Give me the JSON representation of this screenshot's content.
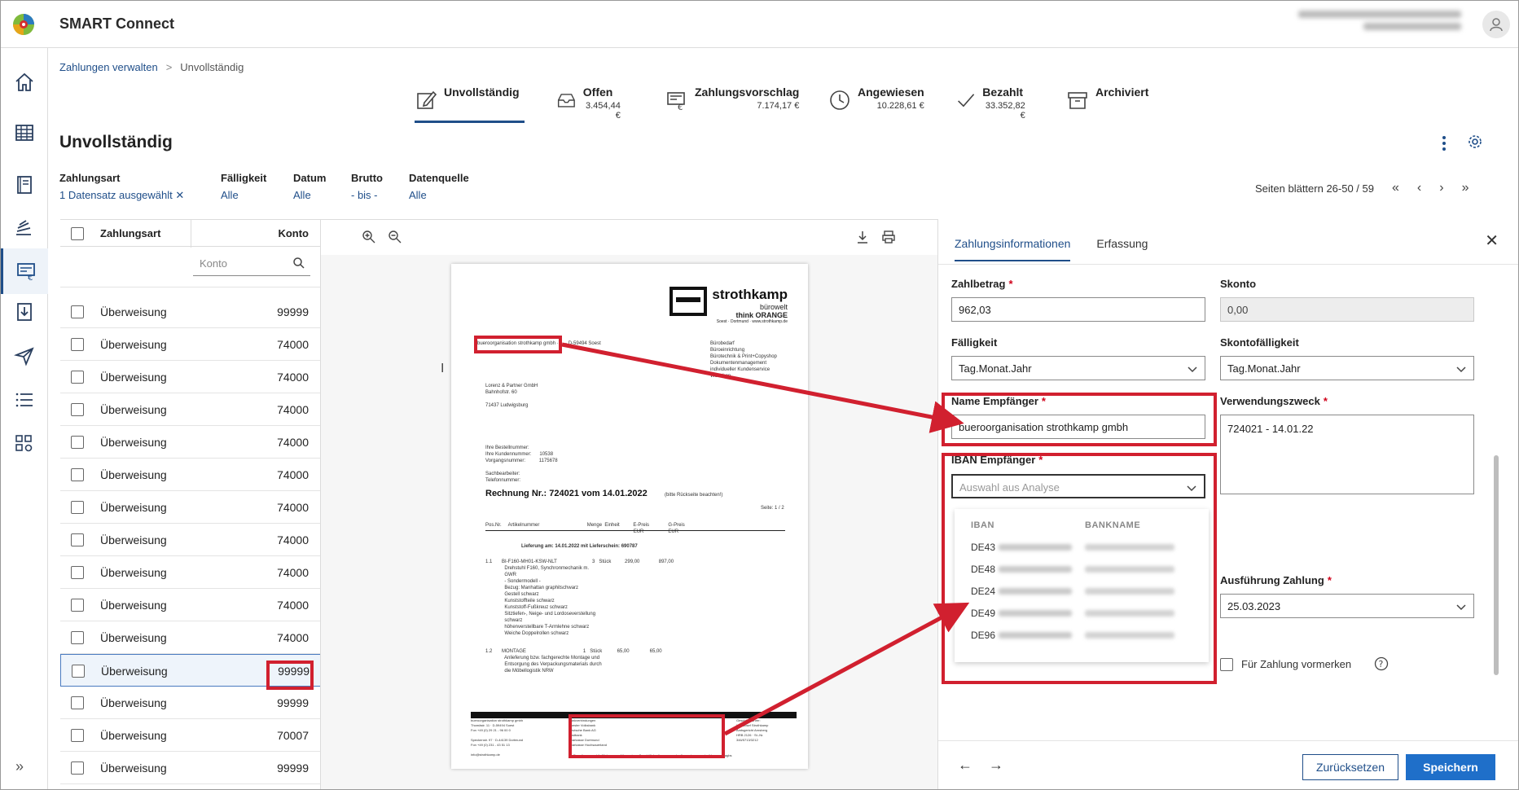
{
  "app": {
    "title": "SMART Connect"
  },
  "breadcrumb": {
    "link": "Zahlungen verwalten",
    "separator": ">",
    "current": "Unvollständig"
  },
  "status_tabs": [
    {
      "label": "Unvollständig",
      "amount": ""
    },
    {
      "label": "Offen",
      "amount": "3.454,44 €"
    },
    {
      "label": "Zahlungsvorschlag",
      "amount": "7.174,17 €"
    },
    {
      "label": "Angewiesen",
      "amount": "10.228,61 €"
    },
    {
      "label": "Bezahlt",
      "amount": "33.352,82 €"
    },
    {
      "label": "Archiviert",
      "amount": ""
    }
  ],
  "page": {
    "title": "Unvollständig"
  },
  "filters": [
    {
      "label": "Zahlungsart",
      "value": "1 Datensatz ausgewählt ✕"
    },
    {
      "label": "Fälligkeit",
      "value": "Alle"
    },
    {
      "label": "Datum",
      "value": "Alle"
    },
    {
      "label": "Brutto",
      "value": "- bis -"
    },
    {
      "label": "Datenquelle",
      "value": "Alle"
    }
  ],
  "pager": {
    "text": "Seiten blättern 26-50 / 59"
  },
  "table": {
    "headers": {
      "zahlungsart": "Zahlungsart",
      "konto": "Konto"
    },
    "konto_filter_placeholder": "Konto",
    "rows": [
      {
        "zahlungsart": "Überweisung",
        "konto": "99999"
      },
      {
        "zahlungsart": "Überweisung",
        "konto": "74000"
      },
      {
        "zahlungsart": "Überweisung",
        "konto": "74000"
      },
      {
        "zahlungsart": "Überweisung",
        "konto": "74000"
      },
      {
        "zahlungsart": "Überweisung",
        "konto": "74000"
      },
      {
        "zahlungsart": "Überweisung",
        "konto": "74000"
      },
      {
        "zahlungsart": "Überweisung",
        "konto": "74000"
      },
      {
        "zahlungsart": "Überweisung",
        "konto": "74000"
      },
      {
        "zahlungsart": "Überweisung",
        "konto": "74000"
      },
      {
        "zahlungsart": "Überweisung",
        "konto": "74000"
      },
      {
        "zahlungsart": "Überweisung",
        "konto": "74000"
      },
      {
        "zahlungsart": "Überweisung",
        "konto": "99999"
      },
      {
        "zahlungsart": "Überweisung",
        "konto": "99999"
      },
      {
        "zahlungsart": "Überweisung",
        "konto": "70007"
      },
      {
        "zahlungsart": "Überweisung",
        "konto": "99999"
      }
    ]
  },
  "document": {
    "logo_name": "strothkamp",
    "logo_sub1": "bürowelt",
    "logo_sub2": "think ORANGE",
    "logo_sub3": "Soest · Dortmund · www.strothkamp.de",
    "sender_line": "bueroorganisation strothkamp gmbh · ... · D-59494 Soest",
    "recipient": "Lorenz & Partner GmbH\nBahnhofstr. 60\n\n71437 Ludwigsburg",
    "services": "Bürobedarf\nBüroeinrichtung\nBürotechnik & Print+Copyshop\nDokumentenmanagement\nindividueller Kundenservice\nWebshop",
    "order_info": "Ihre Bestellnummer:\nIhre Kundennummer:      10538\nVorgangsnummer:          1175678\n\nSachbearbeiter:\nTelefonnummer:",
    "invoice_title": "Rechnung Nr.: 724021 vom 14.01.2022",
    "invoice_note": "(bitte Rückseite beachten!)",
    "page_no": "Seite: 1 / 2",
    "col_headers": "Pos.Nr.     Artikelnummer                                   Menge  Einheit          E-Preis              G-Preis\n                                                                                                             EUR                  EUR",
    "delivery": "Lieferung am: 14.01.2022 mit Lieferschein: 690787",
    "item1": "1.1       BI-F160-MH01-KSW-NLT                          3   Stück          299,00              897,00\n              Drehstuhl F160, Synchronmechanik m.\n              GWR\n              - Sondermodell -\n              Bezug: Manhattan graphitschwarz\n              Gestell schwarz\n              Kunststoffteile schwarz\n              Kunststoff-Fußkreuz schwarz\n              Sitztiefen-, Neige- und Lordoseverstellung\n              schwarz\n              höhenverstellbare T-Armlehne schwarz\n              Weiche Doppelrollen schwarz",
    "item2": "1.2       MONTAGE                                          1   Stück           65,00               65,00\n              Anlieferung bzw. fachgerechte Montage und\n              Entsorgung des Verpackungsmaterials durch\n              die Möbellogistik NRW",
    "footer_left": "bueroorganisation strothkamp gmbh\nThomästr. 11 · D-59494 Soest\nFon +49 (0) 29 21 - 96 00 0\n\nSpeckenstr. 97 · D-44139 Dortmund\nFon +49 (0) 231 - 43 51 13\n\ninfo@strothkamp.de",
    "footer_bank": "Bankverbindungen\nSoester Volksbank\nDeutsche Bank AG\nPostbank\nSparkasse Dortmund\nSparkasse Hochsauerland",
    "footer_right": "Geschäftsführer:\nKarl Josef Strothkamp\nAmtsgericht Arnsberg\nHRB 2126 · St.-Nr.\n346/5713/3212",
    "footer_note": "Es gelten ausschließlich unsere Allgemeinen Geschäftsbedingungen, abrufbar unter www.strothkamp.de/agbs"
  },
  "panel": {
    "tabs": [
      "Zahlungsinformationen",
      "Erfassung"
    ],
    "zahlbetrag_label": "Zahlbetrag",
    "zahlbetrag_value": "962,03",
    "skonto_label": "Skonto",
    "skonto_value": "0,00",
    "faelligkeit_label": "Fälligkeit",
    "faelligkeit_value": "Tag.Monat.Jahr",
    "skontofaelligkeit_label": "Skontofälligkeit",
    "skontofaelligkeit_value": "Tag.Monat.Jahr",
    "name_label": "Name Empfänger",
    "name_value": "bueroorganisation strothkamp gmbh",
    "verwendung_label": "Verwendungszweck",
    "verwendung_value": "724021 - 14.01.22",
    "iban_label": "IBAN Empfänger",
    "iban_placeholder": "Auswahl aus Analyse",
    "dropdown_headers": {
      "iban": "IBAN",
      "bank": "BANKNAME"
    },
    "dropdown_rows": [
      "DE43",
      "DE48",
      "DE24",
      "DE49",
      "DE96"
    ],
    "ausfuehrung_label": "Ausführung Zahlung",
    "ausfuehrung_value": "25.03.2023",
    "vormerken_label": "Für Zahlung vormerken",
    "reset_label": "Zurücksetzen",
    "save_label": "Speichern",
    "required_mark": "*"
  },
  "colors": {
    "primary": "#1f4e89",
    "button": "#1f6fc9",
    "annotation": "#d1202f"
  }
}
